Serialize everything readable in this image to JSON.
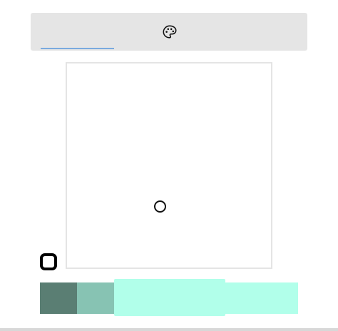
{
  "toolbar": {
    "tabs": [
      {
        "name": "tab-1",
        "icon": "none"
      },
      {
        "name": "tab-palette",
        "icon": "palette-icon"
      },
      {
        "name": "tab-3",
        "icon": "none"
      }
    ],
    "underline_color": "#7aaadf"
  },
  "color_field": {
    "background": "#ffffff"
  },
  "swatches": [
    {
      "color": "#5a7e73"
    },
    {
      "color": "#87c3b3"
    },
    {
      "color": "#b1ffea",
      "selected": true
    },
    {
      "color": "#b1ffea"
    }
  ]
}
